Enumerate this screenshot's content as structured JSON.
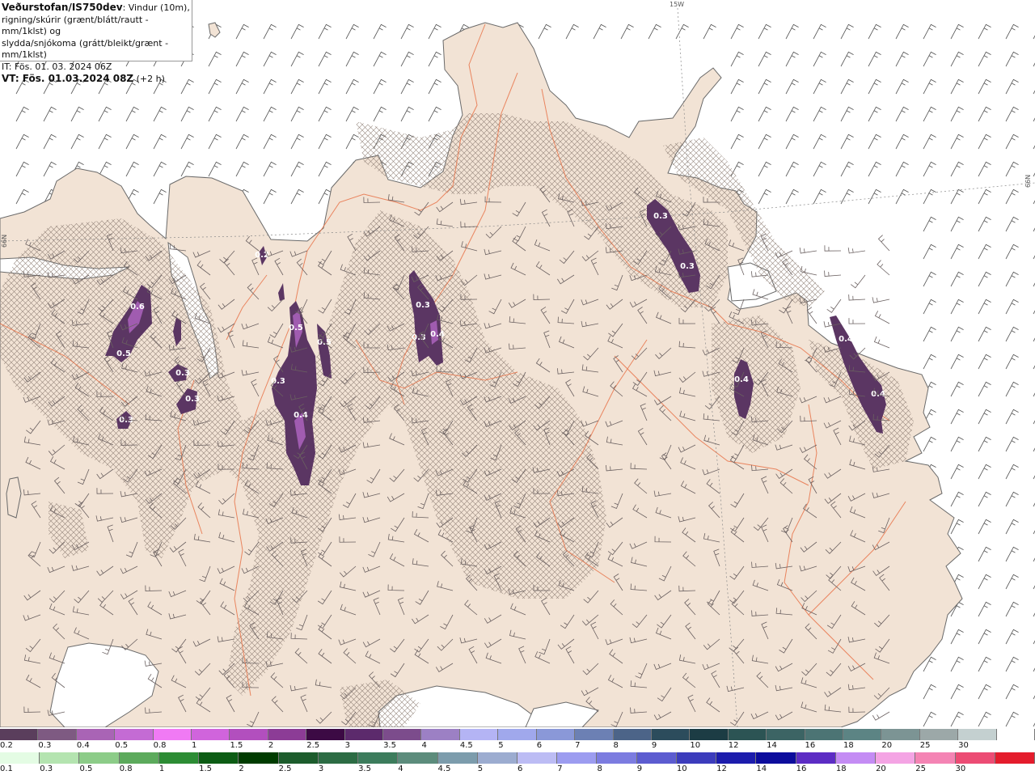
{
  "title": {
    "line1_bold": "Veðurstofan/IS750dev",
    "line1_rest": ": Vindur (10m),",
    "line2": "rigning/skúrir (grænt/blátt/rautt - mm/1klst) og",
    "line3": "slydda/snjókoma (grátt/bleikt/grænt - mm/1klst)",
    "line4": "IT: Fös. 01. 03. 2024 06Z",
    "line5_bold": "VT: Fös. 01.03.2024 08Z",
    "line5_rest": " (+2 h)"
  },
  "gridlabels": {
    "lon": "15W",
    "lat_right": "66N",
    "lat_left": "66N"
  },
  "precip_labels": [
    "0.6",
    "0.5",
    "0.5",
    "0.3",
    "0.3",
    "0.3",
    "0.5",
    "0.2",
    "0.3",
    "0.4",
    "0.3",
    "0.3",
    "0.4",
    "0.3",
    "0.3",
    "0.4",
    "0.4",
    "0.4"
  ],
  "colors": {
    "land": "#f2e3d5",
    "sea": "#ffffff",
    "roads": "#e8744a",
    "coast": "#6a6a6a",
    "precip_dark": "#5b3663",
    "precip_mid": "#8a4a97",
    "precip_light": "#d462e0"
  },
  "legend_top": {
    "labels": [
      "0.2",
      "0.3",
      "0.4",
      "0.5",
      "0.8",
      "1",
      "1.5",
      "2",
      "2.5",
      "3",
      "3.5",
      "4",
      "4.5",
      "5",
      "6",
      "7",
      "8",
      "9",
      "10",
      "12",
      "14",
      "16",
      "18",
      "20",
      "25",
      "30"
    ],
    "colors": [
      "#5a3e5c",
      "#7e5a82",
      "#a964b5",
      "#c46bd4",
      "#f07af4",
      "#d064dc",
      "#b24fbe",
      "#8c3c96",
      "#3c0a44",
      "#5c2a6c",
      "#7c4c8c",
      "#9c80c4",
      "#b4b4f4",
      "#a0a8ec",
      "#8a98d8",
      "#6c80b4",
      "#4c6488",
      "#2c4c5c",
      "#1c3c44",
      "#2c5454",
      "#3c6464",
      "#4c7474",
      "#5c8484",
      "#7c9494",
      "#9ca8a8",
      "#c4d0d0",
      "#ffffff"
    ]
  },
  "legend_bottom": {
    "labels": [
      "0.1",
      "0.3",
      "0.5",
      "0.8",
      "1",
      "1.5",
      "2",
      "2.5",
      "3",
      "3.5",
      "4",
      "4.5",
      "5",
      "6",
      "7",
      "8",
      "9",
      "10",
      "12",
      "14",
      "16",
      "18",
      "20",
      "25",
      "30"
    ],
    "colors": [
      "#e4fce4",
      "#b4e4b0",
      "#8ccc88",
      "#5caa5c",
      "#2c8c34",
      "#0c5c14",
      "#003c00",
      "#1c5c2c",
      "#2c6c44",
      "#3c7c5c",
      "#5c8c7c",
      "#7c9cac",
      "#9cacd0",
      "#bcbcf4",
      "#9c9cf0",
      "#7c7ce0",
      "#5c5cd0",
      "#3c3cbc",
      "#1c1cac",
      "#0c0c9c",
      "#5c2cc4",
      "#c48cf4",
      "#f4a4e4",
      "#f484b4",
      "#ec4c74",
      "#e41c2c"
    ]
  }
}
